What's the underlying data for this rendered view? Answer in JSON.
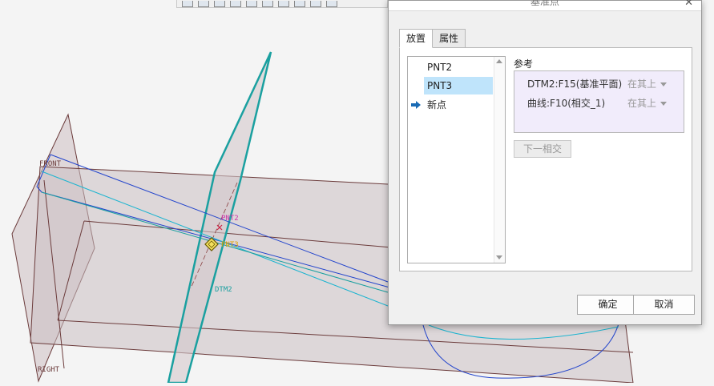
{
  "viewport": {
    "datum_labels": {
      "front": "FRONT",
      "right": "RIGHT",
      "dtm2": "DTM2"
    },
    "point_labels": {
      "pnt2": "PNT2",
      "pnt3": "PNT3"
    },
    "colors": {
      "plane_edge": "#6b3b3b",
      "plane_fill": "#c7b8bc",
      "dtm2_edge": "#1aa0a0",
      "curve_blue": "#2244cc",
      "curve_cyan": "#1ab4d0",
      "pnt2_label": "#cc33aa",
      "pnt3_label": "#e0a000"
    }
  },
  "dialog": {
    "title": "基准点",
    "tabs": [
      {
        "label": "放置",
        "active": true
      },
      {
        "label": "属性",
        "active": false
      }
    ],
    "points": [
      {
        "label": "PNT2"
      },
      {
        "label": "PNT3",
        "selected": true
      }
    ],
    "new_point_label": "新点",
    "references_label": "参考",
    "references": [
      {
        "name": "DTM2:F15(基准平面)",
        "mode": "在其上"
      },
      {
        "name": "曲线:F10(相交_1)",
        "mode": "在其上"
      }
    ],
    "next_intersection_label": "下一相交",
    "ok_label": "确定",
    "cancel_label": "取消"
  }
}
